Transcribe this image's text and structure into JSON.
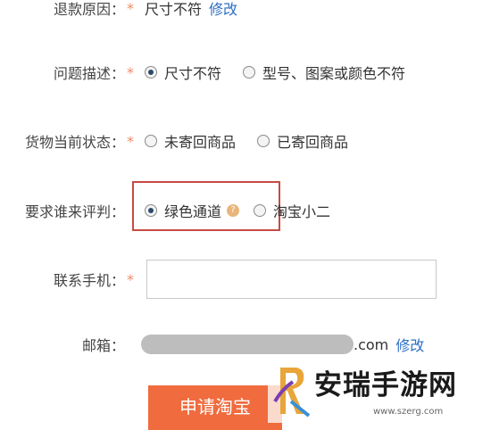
{
  "form": {
    "refund_reason": {
      "label": "退款原因：",
      "required": "*",
      "value": "尺寸不符",
      "edit": "修改"
    },
    "problem_desc": {
      "label": "问题描述：",
      "required": "*",
      "options": [
        "尺寸不符",
        "型号、图案或颜色不符"
      ],
      "selected": 0
    },
    "goods_status": {
      "label": "货物当前状态：",
      "required": "*",
      "options": [
        "未寄回商品",
        "已寄回商品"
      ]
    },
    "arbitrator": {
      "label": "要求谁来评判：",
      "options": [
        "绿色通道",
        "淘宝小二"
      ],
      "selected": 0,
      "help_icon": "?"
    },
    "phone": {
      "label": "联系手机：",
      "required": "*",
      "value": "",
      "placeholder": ""
    },
    "email": {
      "label": "邮箱：",
      "suffix": ".com",
      "edit": "修改"
    },
    "submit_label": "申请淘宝"
  },
  "watermark": {
    "title": "安瑞手游网",
    "url": "www.szerg.com"
  },
  "colors": {
    "required_star": "#f08a66",
    "link": "#2c6fc4",
    "highlight_border": "#c94a44",
    "submit_bg": "#f06b3e"
  }
}
